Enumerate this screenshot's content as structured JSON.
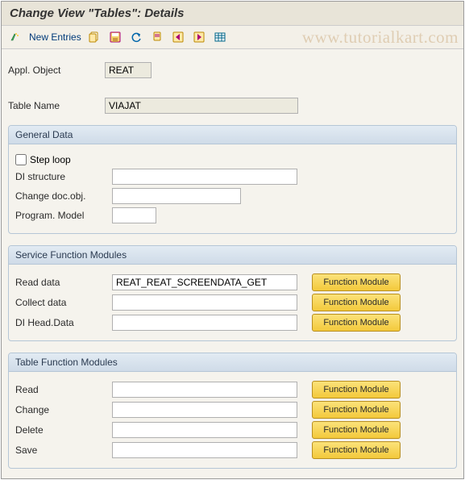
{
  "title": "Change View \"Tables\": Details",
  "toolbar": {
    "new_entries": "New Entries"
  },
  "watermark": "www.tutorialkart.com",
  "header": {
    "appl_object_label": "Appl. Object",
    "appl_object_value": "REAT",
    "table_name_label": "Table Name",
    "table_name_value": "VIAJAT"
  },
  "general": {
    "title": "General Data",
    "step_loop_label": "Step loop",
    "step_loop_checked": false,
    "di_structure_label": "DI structure",
    "di_structure_value": "",
    "change_doc_label": "Change doc.obj.",
    "change_doc_value": "",
    "program_model_label": "Program. Model",
    "program_model_value": ""
  },
  "service_fm": {
    "title": "Service Function Modules",
    "btn": "Function Module",
    "rows": [
      {
        "label": "Read data",
        "value": "REAT_REAT_SCREENDATA_GET"
      },
      {
        "label": "Collect data",
        "value": ""
      },
      {
        "label": "DI Head.Data",
        "value": ""
      }
    ]
  },
  "table_fm": {
    "title": "Table Function Modules",
    "btn": "Function Module",
    "rows": [
      {
        "label": "Read",
        "value": ""
      },
      {
        "label": "Change",
        "value": ""
      },
      {
        "label": "Delete",
        "value": ""
      },
      {
        "label": "Save",
        "value": ""
      }
    ]
  }
}
